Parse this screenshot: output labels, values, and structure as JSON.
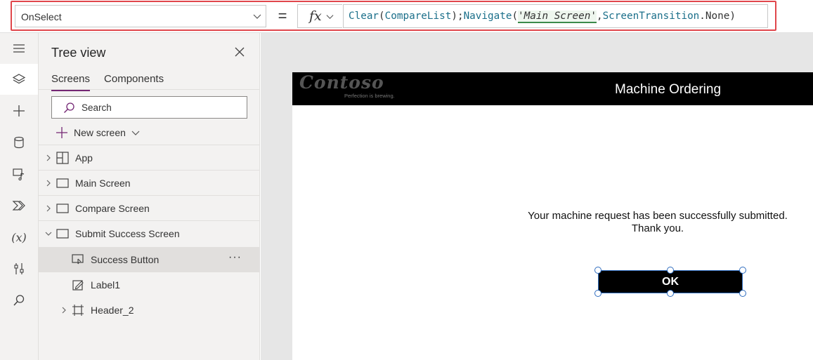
{
  "formula_bar": {
    "property": "OnSelect",
    "equals": "=",
    "fx": "fx",
    "tokens": [
      {
        "t": "Clear",
        "k": "fn"
      },
      {
        "t": "(",
        "k": "p"
      },
      {
        "t": "CompareList",
        "k": "fn"
      },
      {
        "t": ");",
        "k": "p"
      },
      {
        "t": "Navigate",
        "k": "fn"
      },
      {
        "t": "(",
        "k": "p"
      },
      {
        "t": "'Main Screen'",
        "k": "str"
      },
      {
        "t": ",",
        "k": "p"
      },
      {
        "t": "ScreenTransition",
        "k": "fn"
      },
      {
        "t": ".None)",
        "k": "p"
      }
    ]
  },
  "rail": {
    "items": [
      "menu-icon",
      "layers-icon",
      "add-icon",
      "data-icon",
      "media-icon",
      "power-automate-icon",
      "variables-icon",
      "tools-icon",
      "search-icon"
    ],
    "variables_text": "(x)"
  },
  "tree": {
    "title": "Tree view",
    "tabs": [
      "Screens",
      "Components"
    ],
    "search_placeholder": "Search",
    "new_screen": "New screen",
    "nodes": {
      "app": "App",
      "main_screen": "Main Screen",
      "compare_screen": "Compare Screen",
      "submit_success_screen": "Submit Success Screen",
      "success_button": "Success Button",
      "label1": "Label1",
      "header_2": "Header_2"
    },
    "more": "···"
  },
  "app_screen": {
    "logo": "Contoso",
    "logo_tagline": "Perfection is brewing.",
    "title": "Machine Ordering",
    "message_line1": "Your machine request has been successfully submitted.",
    "message_line2": "Thank you.",
    "ok_button": "OK"
  },
  "colors": {
    "highlight_border": "#e0464b",
    "function_token": "#1b6f8a",
    "tab_underline": "#742774",
    "selection_blue": "#2f6dbf",
    "app_header": "#000000"
  }
}
